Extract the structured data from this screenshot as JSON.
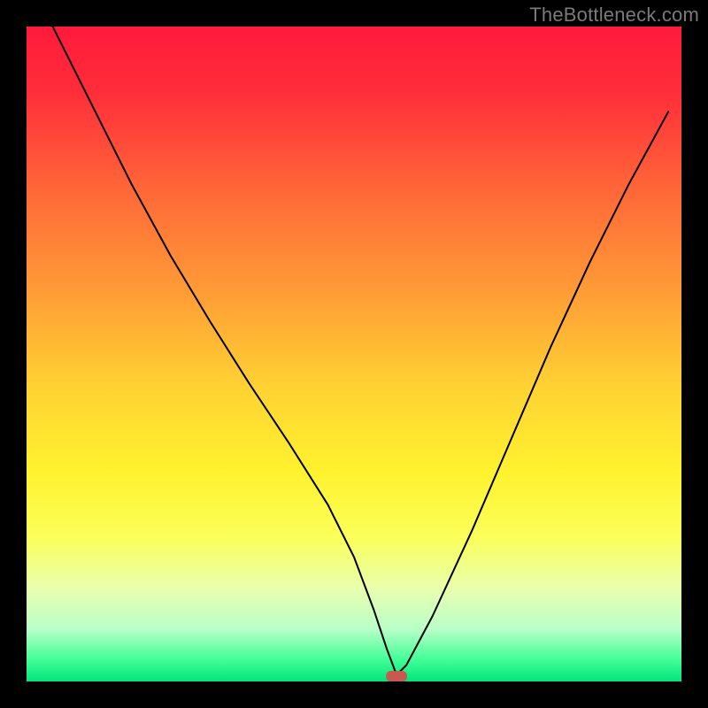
{
  "watermark": "TheBottleneck.com",
  "chart_data": {
    "type": "line",
    "title": "",
    "xlabel": "",
    "ylabel": "",
    "xlim": [
      0,
      100
    ],
    "ylim": [
      0,
      100
    ],
    "axes_visible": false,
    "background_gradient": [
      {
        "offset": 0.0,
        "color": "#ff1a3b"
      },
      {
        "offset": 0.1,
        "color": "#ff2d3a"
      },
      {
        "offset": 0.25,
        "color": "#ff6738"
      },
      {
        "offset": 0.4,
        "color": "#ff9a36"
      },
      {
        "offset": 0.55,
        "color": "#ffd233"
      },
      {
        "offset": 0.68,
        "color": "#fff22e"
      },
      {
        "offset": 0.78,
        "color": "#fbff5a"
      },
      {
        "offset": 0.86,
        "color": "#e8ffb0"
      },
      {
        "offset": 0.92,
        "color": "#b9ffc8"
      },
      {
        "offset": 0.965,
        "color": "#46ff99"
      },
      {
        "offset": 1.0,
        "color": "#00e57a"
      }
    ],
    "series": [
      {
        "name": "bottleneck-curve",
        "stroke": "#000000",
        "stroke_width": 2,
        "x": [
          4,
          10,
          16,
          22,
          28,
          34,
          40,
          46,
          50,
          53,
          55,
          56.5,
          58,
          62,
          68,
          74,
          80,
          86,
          92,
          98
        ],
        "y": [
          100,
          88,
          76,
          65,
          55,
          45.5,
          36.5,
          27,
          19,
          11,
          5,
          1,
          2.5,
          10,
          23,
          37,
          51,
          64,
          76,
          87
        ]
      }
    ],
    "marker": {
      "name": "sweet-spot",
      "shape": "rounded-rect",
      "x": 56.5,
      "y": 0.8,
      "width_pct": 3.2,
      "height_pct": 1.6,
      "fill": "#c9594e"
    },
    "frame": {
      "stroke": "#000000",
      "stroke_width": 30
    }
  }
}
